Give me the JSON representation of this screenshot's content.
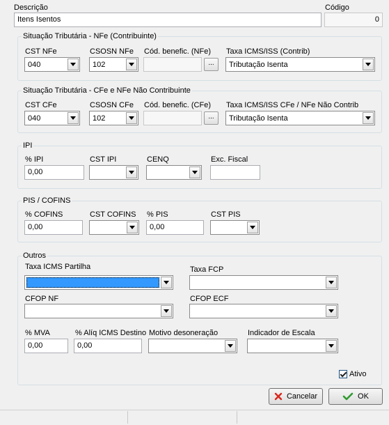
{
  "header": {
    "descricao_label": "Descrição",
    "descricao_value": "Itens Isentos",
    "codigo_label": "Código",
    "codigo_value": "0"
  },
  "nfe": {
    "title": "Situação Tributária - NFe (Contribuinte)",
    "cst_label": "CST NFe",
    "cst_value": "040",
    "csosn_label": "CSOSN NFe",
    "csosn_value": "102",
    "benef_label": "Cód. benefic. (NFe)",
    "benef_value": "",
    "ellipsis": "...",
    "taxa_label": "Taxa ICMS/ISS (Contrib)",
    "taxa_value": "Tributação Isenta"
  },
  "cfe": {
    "title": "Situação Tributária - CFe e NFe Não Contribuinte",
    "cst_label": "CST CFe",
    "cst_value": "040",
    "csosn_label": "CSOSN CFe",
    "csosn_value": "102",
    "benef_label": "Cód. benefic. (CFe)",
    "benef_value": "",
    "ellipsis": "...",
    "taxa_label": "Taxa ICMS/ISS CFe / NFe Não Contrib",
    "taxa_value": "Tributação Isenta"
  },
  "ipi": {
    "title": "IPI",
    "pct_label": "% IPI",
    "pct_value": "0,00",
    "cst_label": "CST IPI",
    "cst_value": "",
    "cenq_label": "CENQ",
    "cenq_value": "",
    "exc_label": "Exc. Fiscal",
    "exc_value": ""
  },
  "pis": {
    "title": "PIS / COFINS",
    "cofins_label": "% COFINS",
    "cofins_value": "0,00",
    "cst_cofins_label": "CST COFINS",
    "cst_cofins_value": "",
    "pis_label": "% PIS",
    "pis_value": "0,00",
    "cst_pis_label": "CST PIS",
    "cst_pis_value": ""
  },
  "outros": {
    "title": "Outros",
    "partilha_label": "Taxa ICMS Partilha",
    "partilha_value": "",
    "fcp_label": "Taxa FCP",
    "fcp_value": "",
    "cfop_nf_label": "CFOP NF",
    "cfop_nf_value": "",
    "cfop_ecf_label": "CFOP ECF",
    "cfop_ecf_value": "",
    "mva_label": "% MVA",
    "mva_value": "0,00",
    "aliq_label": "% Alíq ICMS Destino",
    "aliq_value": "0,00",
    "motivo_label": "Motivo desoneração",
    "motivo_value": "",
    "escala_label": "Indicador de Escala",
    "escala_value": ""
  },
  "ativo": {
    "label": "Ativo",
    "checked": true
  },
  "buttons": {
    "cancel": "Cancelar",
    "ok": "OK"
  },
  "colors": {
    "selection": "#3399ff",
    "cancel_icon": "#d9261c",
    "ok_icon": "#2e9a2e"
  },
  "icons": {
    "cancel": "x-icon",
    "ok": "checkmark-icon",
    "dropdown": "chevron-down-icon"
  }
}
